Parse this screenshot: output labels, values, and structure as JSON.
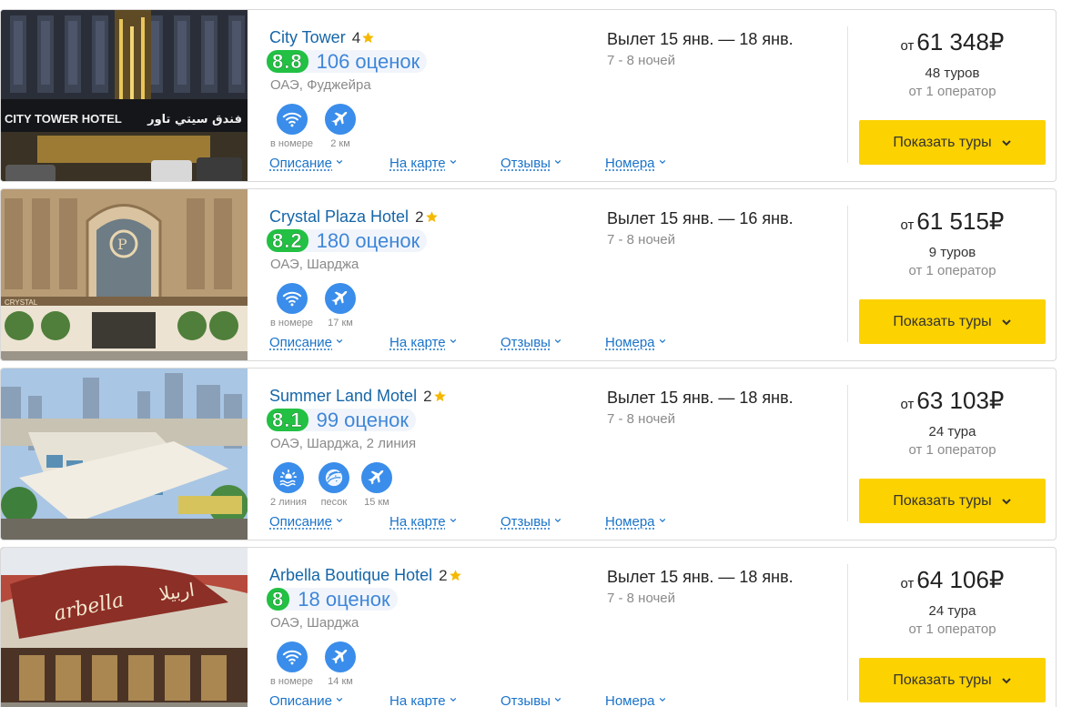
{
  "ui": {
    "show_tours_label": "Показать туры",
    "price_prefix": "от",
    "links": [
      "Описание",
      "На карте",
      "Отзывы",
      "Номера"
    ]
  },
  "colors": {
    "hotel_name": "#1666a8",
    "score_bg": "#22c043",
    "reviews": "#3f86d8",
    "amenity_icon_bg": "#3a8dea",
    "button_bg": "#fcd201",
    "star": "#f5b800"
  },
  "hotels": [
    {
      "name": "City Tower",
      "stars": "4",
      "score": "8.8",
      "reviews": "106 оценок",
      "location": "ОАЭ, Фуджейра",
      "amenities": [
        {
          "icon": "wifi-icon",
          "label": "в номере"
        },
        {
          "icon": "airport-distance-icon",
          "label": "2 км"
        }
      ],
      "dates": "Вылет 15 янв. — 18 янв.",
      "nights": "7 - 8 ночей",
      "price": "61 348₽",
      "tours": "48 туров",
      "operators": "от 1 оператор",
      "photo_sign_left": "CITY TOWER HOTEL",
      "photo_sign_right": "فندق سيتي تاور"
    },
    {
      "name": "Crystal Plaza Hotel",
      "stars": "2",
      "score": "8.2",
      "reviews": "180 оценок",
      "location": "ОАЭ, Шарджа",
      "amenities": [
        {
          "icon": "wifi-icon",
          "label": "в номере"
        },
        {
          "icon": "airport-distance-icon",
          "label": "17 км"
        }
      ],
      "dates": "Вылет 15 янв. — 16 янв.",
      "nights": "7 - 8 ночей",
      "price": "61 515₽",
      "tours": "9 туров",
      "operators": "от 1 оператор",
      "photo_sign_left": "CRYSTAL",
      "photo_sign_right": ""
    },
    {
      "name": "Summer Land Motel",
      "stars": "2",
      "score": "8.1",
      "reviews": "99 оценок",
      "location": "ОАЭ, Шарджа, 2 линия",
      "amenities": [
        {
          "icon": "beach-line-icon",
          "label": "2 линия"
        },
        {
          "icon": "sand-icon",
          "label": "песок"
        },
        {
          "icon": "airport-distance-icon",
          "label": "15 км"
        }
      ],
      "dates": "Вылет 15 янв. — 18 янв.",
      "nights": "7 - 8 ночей",
      "price": "63 103₽",
      "tours": "24 тура",
      "operators": "от 1 оператор",
      "photo_sign_left": "",
      "photo_sign_right": ""
    },
    {
      "name": "Arbella Boutique Hotel",
      "stars": "2",
      "score": "8",
      "reviews": "18 оценок",
      "location": "ОАЭ, Шарджа",
      "amenities": [
        {
          "icon": "wifi-icon",
          "label": "в номере"
        },
        {
          "icon": "airport-distance-icon",
          "label": "14 км"
        }
      ],
      "dates": "Вылет 15 янв. — 18 янв.",
      "nights": "7 - 8 ночей",
      "price": "64 106₽",
      "tours": "24 тура",
      "operators": "от 1 оператор",
      "photo_sign_left": "arbella",
      "photo_sign_right": "اربيلا"
    }
  ]
}
